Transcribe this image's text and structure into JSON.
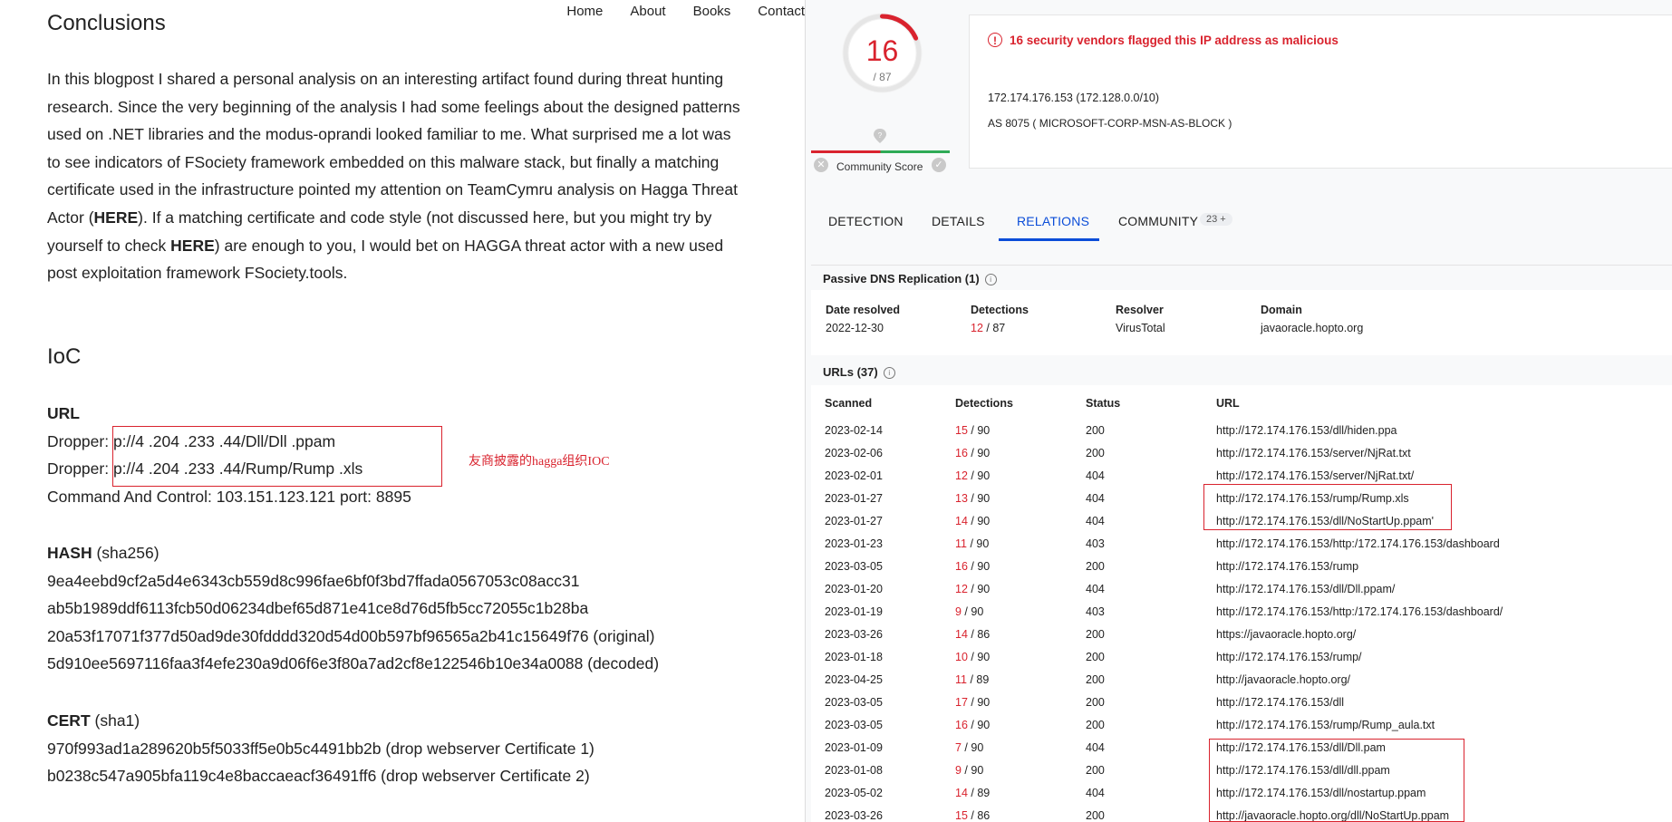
{
  "blog": {
    "nav": [
      "Home",
      "About",
      "Books",
      "Contact"
    ],
    "conclusions_title": "Conclusions",
    "para": {
      "part1": "In this blogpost I shared a personal analysis on an interesting artifact found during threat hunting research. Since the very beginning of the analysis I had some feelings about the designed patterns used on .NET libraries and the modus-oprandi looked familiar to me. What surprised me a lot was to see indicators of FSociety framework embedded on this malware stack, but finally a matching certificate used in the infrastructure pointed my attention on TeamCymru analysis on Hagga Threat Actor (",
      "here1": "HERE",
      "part2": "). If a matching certificate and code style (not discussed here, but you might try by yourself to check ",
      "here2": "HERE",
      "part3": ") are enough to you, I would bet on HAGGA threat actor with a new used post exploitation framework FSociety.tools."
    },
    "ioc_title": "IoC",
    "url_label": "URL",
    "dropper1": "Dropper: p://4 .204 .233 .44/Dll/Dll .ppam",
    "dropper2": "Dropper: p://4 .204 .233 .44/Rump/Rump .xls",
    "c2": "Command And Control: 103.151.123.121 port: 8895",
    "hash_label": "HASH",
    "hash_suffix": " (sha256)",
    "hashes": [
      "9ea4eebd9cf2a5d4e6343cb559d8c996fae6bf0f3bd7ffada0567053c08acc31",
      "ab5b1989ddf6113fcb50d06234dbef65d871e41ce8d76d5fb5cc72055c1b28ba",
      "20a53f17071f377d50ad9de30fdddd320d54d00b597bf96565a2b41c15649f76 (original)",
      "5d910ee5697116faa3f4efe230a9d06f6e3f80a7ad2cf8e122546b10e34a0088 (decoded)"
    ],
    "cert_label": "CERT",
    "cert_suffix": " (sha1)",
    "certs": [
      "970f993ad1a289620b5f5033ff5e0b5c4491bb2b (drop webserver Certificate 1)",
      "b0238c547a905bfa119c4e8baccaeacf36491ff6 (drop webserver Certificate 2)"
    ],
    "annotation": "友商披露的hagga组织IOC"
  },
  "vt": {
    "score": "16",
    "score_total": "/ 87",
    "community_label": "Community Score",
    "flag_text": "16 security vendors flagged this IP address as malicious",
    "ip": "172.174.176.153  (172.128.0.0/10)",
    "as": "AS 8075 ( MICROSOFT-CORP-MSN-AS-BLOCK )",
    "tabs": [
      "DETECTION",
      "DETAILS",
      "RELATIONS",
      "COMMUNITY"
    ],
    "community_count": "23 +",
    "pdns": {
      "title": "Passive DNS Replication",
      "count": "(1)",
      "headers": [
        "Date resolved",
        "Detections",
        "Resolver",
        "Domain"
      ],
      "row": {
        "date": "2022-12-30",
        "det": "12",
        "tot": " / 87",
        "resolver": "VirusTotal",
        "domain": "javaoracle.hopto.org"
      }
    },
    "urls": {
      "title": "URLs",
      "count": "(37)",
      "headers": [
        "Scanned",
        "Detections",
        "Status",
        "URL"
      ],
      "rows": [
        {
          "scanned": "2023-02-14",
          "det": "15",
          "tot": " / 90",
          "status": "200",
          "url": "http://172.174.176.153/dll/hiden.ppa"
        },
        {
          "scanned": "2023-02-06",
          "det": "16",
          "tot": " / 90",
          "status": "200",
          "url": "http://172.174.176.153/server/NjRat.txt"
        },
        {
          "scanned": "2023-02-01",
          "det": "12",
          "tot": " / 90",
          "status": "404",
          "url": "http://172.174.176.153/server/NjRat.txt/"
        },
        {
          "scanned": "2023-01-27",
          "det": "13",
          "tot": " / 90",
          "status": "404",
          "url": "http://172.174.176.153/rump/Rump.xls"
        },
        {
          "scanned": "2023-01-27",
          "det": "14",
          "tot": " / 90",
          "status": "404",
          "url": "http://172.174.176.153/dll/NoStartUp.ppam'"
        },
        {
          "scanned": "2023-01-23",
          "det": "11",
          "tot": " / 90",
          "status": "403",
          "url": "http://172.174.176.153/http:/172.174.176.153/dashboard"
        },
        {
          "scanned": "2023-03-05",
          "det": "16",
          "tot": " / 90",
          "status": "200",
          "url": "http://172.174.176.153/rump"
        },
        {
          "scanned": "2023-01-20",
          "det": "12",
          "tot": " / 90",
          "status": "404",
          "url": "http://172.174.176.153/dll/Dll.ppam/"
        },
        {
          "scanned": "2023-01-19",
          "det": "9",
          "tot": " / 90",
          "status": "403",
          "url": "http://172.174.176.153/http:/172.174.176.153/dashboard/"
        },
        {
          "scanned": "2023-03-26",
          "det": "14",
          "tot": " / 86",
          "status": "200",
          "url": "https://javaoracle.hopto.org/"
        },
        {
          "scanned": "2023-01-18",
          "det": "10",
          "tot": " / 90",
          "status": "200",
          "url": "http://172.174.176.153/rump/"
        },
        {
          "scanned": "2023-04-25",
          "det": "11",
          "tot": " / 89",
          "status": "200",
          "url": "http://javaoracle.hopto.org/"
        },
        {
          "scanned": "2023-03-05",
          "det": "17",
          "tot": " / 90",
          "status": "200",
          "url": "http://172.174.176.153/dll"
        },
        {
          "scanned": "2023-03-05",
          "det": "16",
          "tot": " / 90",
          "status": "200",
          "url": "http://172.174.176.153/rump/Rump_aula.txt"
        },
        {
          "scanned": "2023-01-09",
          "det": "7",
          "tot": " / 90",
          "status": "404",
          "url": "http://172.174.176.153/dll/Dll.pam"
        },
        {
          "scanned": "2023-01-08",
          "det": "9",
          "tot": " / 90",
          "status": "200",
          "url": "http://172.174.176.153/dll/dll.ppam"
        },
        {
          "scanned": "2023-05-02",
          "det": "14",
          "tot": " / 89",
          "status": "404",
          "url": "http://172.174.176.153/dll/nostartup.ppam"
        },
        {
          "scanned": "2023-03-26",
          "det": "15",
          "tot": " / 86",
          "status": "200",
          "url": "http://javaoracle.hopto.org/dll/NoStartUp.ppam"
        }
      ]
    }
  },
  "colors": {
    "malicious": "#d9232e",
    "accent": "#0b4dd8",
    "clean": "#2eaa56"
  }
}
